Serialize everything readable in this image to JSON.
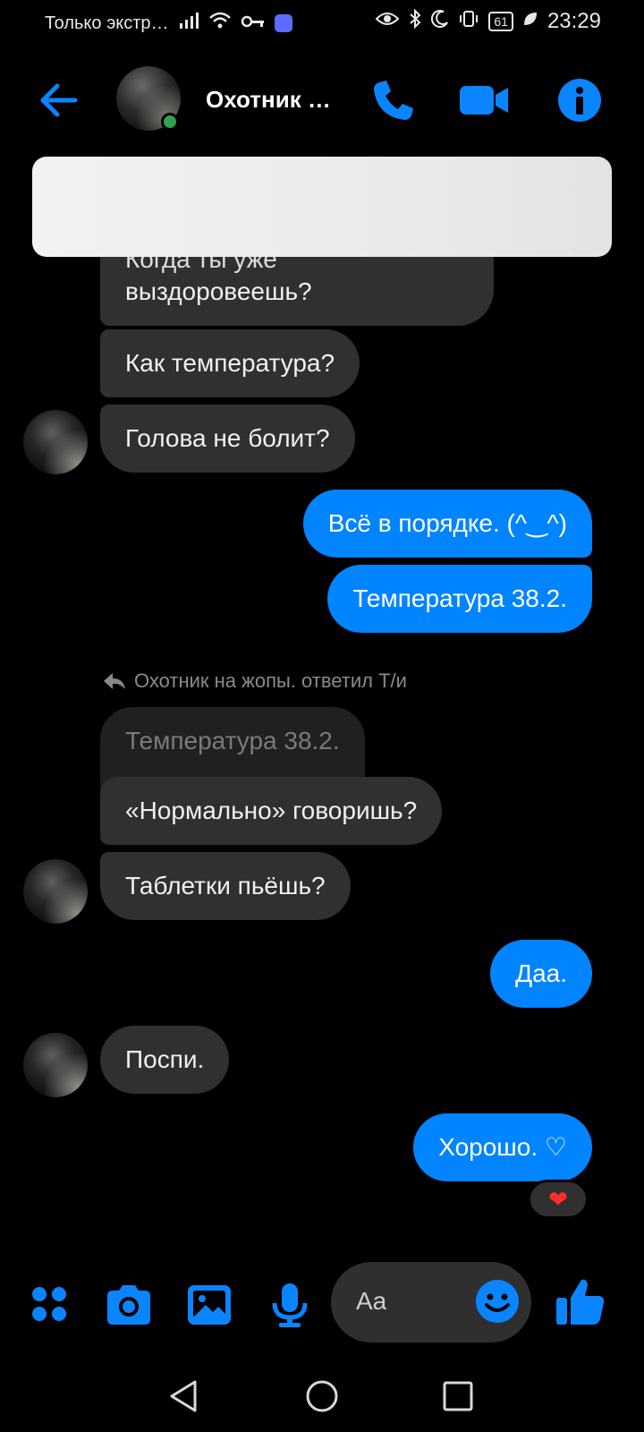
{
  "status_bar": {
    "carrier": "Только экстр…",
    "battery": "61",
    "time": "23:29"
  },
  "header": {
    "contact_name": "Охотник …",
    "online": true
  },
  "messages": {
    "m1_line1": "Когда ты уже",
    "m1_line2": "выздоровеешь?",
    "m2": "Как температура?",
    "m3": "Голова не болит?",
    "m4": "Всё в порядке. (^‿^)",
    "m5": "Температура 38.2.",
    "reply_note": "Охотник на жопы. ответил Т/и",
    "quoted": "Температура 38.2.",
    "m6": "«Нормально» говоришь?",
    "m7": "Таблетки пьёшь?",
    "m8": "Даа.",
    "m9": "Поспи.",
    "m10": "Хорошо. ♡",
    "reaction": "❤"
  },
  "composer": {
    "placeholder": "Aa"
  },
  "colors": {
    "accent": "#0084ff",
    "incoming_bubble": "#303030",
    "background": "#000000"
  },
  "icons": {
    "header": [
      "back-arrow-icon",
      "phone-icon",
      "video-camera-icon",
      "info-icon"
    ],
    "composer": [
      "apps-grid-icon",
      "camera-icon",
      "gallery-icon",
      "microphone-icon",
      "emoji-icon",
      "thumbs-up-icon"
    ],
    "nav": [
      "nav-back-icon",
      "nav-home-icon",
      "nav-recents-icon"
    ]
  }
}
